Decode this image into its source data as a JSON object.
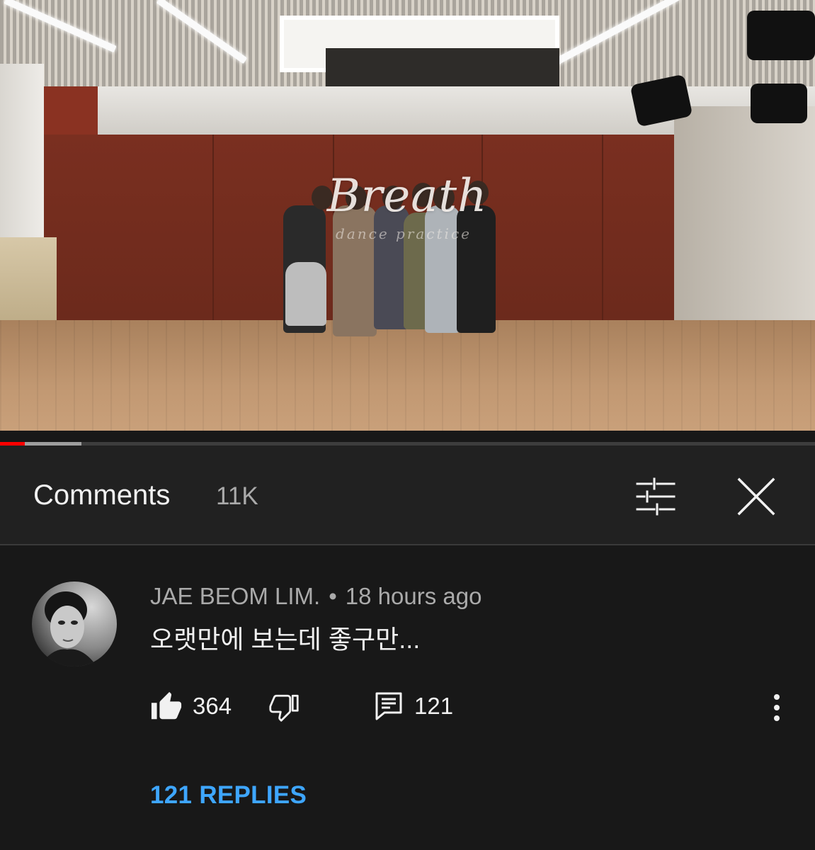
{
  "video": {
    "overlay_title": "Breath",
    "overlay_subtitle": "dance practice",
    "progress_played_fraction": 0.03,
    "progress_buffered_fraction": 0.1
  },
  "comments_panel": {
    "title": "Comments",
    "count": "11K",
    "sort_icon": "sort-filter-icon",
    "close_icon": "close-icon"
  },
  "comment": {
    "author": "JAE BEOM LIM.",
    "separator": "•",
    "time": "18 hours ago",
    "text": "오랫만에 보는데 좋구만...",
    "likes": "364",
    "replies_count": "121",
    "replies_link": "121 REPLIES",
    "icons": {
      "like": "thumbs-up-filled-icon",
      "dislike": "thumbs-down-icon",
      "reply": "reply-comment-icon",
      "more": "more-vertical-icon"
    }
  },
  "colors": {
    "background": "#181818",
    "header_background": "#212121",
    "link_blue": "#3ea6ff",
    "progress_red": "#ff0000",
    "muted_text": "#aaaaaa"
  }
}
